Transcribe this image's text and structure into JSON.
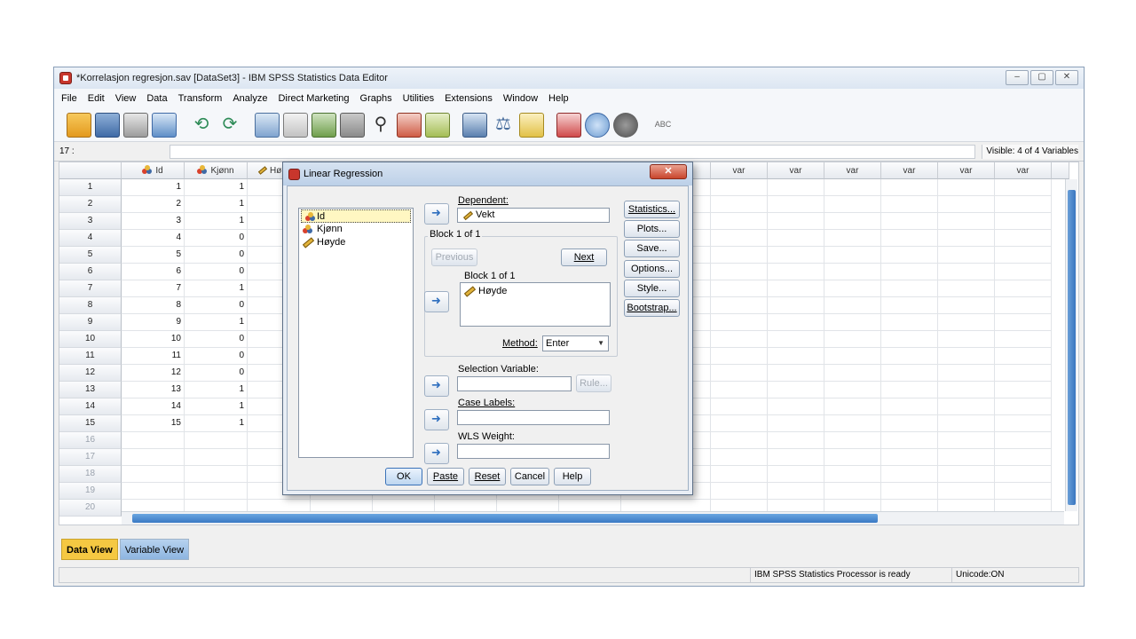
{
  "window": {
    "title": "*Korrelasjon regresjon.sav [DataSet3] - IBM SPSS Statistics Data Editor",
    "controls": [
      "–",
      "▢",
      "✕"
    ]
  },
  "menu": [
    "File",
    "Edit",
    "View",
    "Data",
    "Transform",
    "Analyze",
    "Direct Marketing",
    "Graphs",
    "Utilities",
    "Extensions",
    "Window",
    "Help"
  ],
  "cellbar": {
    "ref": "17 :",
    "visible": "Visible: 4 of 4 Variables"
  },
  "grid": {
    "columns": [
      "Id",
      "Kjønn",
      "Hø",
      "var",
      "var",
      "var",
      "var",
      "var",
      "var"
    ],
    "rows": [
      {
        "n": "1",
        "id": "1",
        "kjonn": "1"
      },
      {
        "n": "2",
        "id": "2",
        "kjonn": "1"
      },
      {
        "n": "3",
        "id": "3",
        "kjonn": "1"
      },
      {
        "n": "4",
        "id": "4",
        "kjonn": "0"
      },
      {
        "n": "5",
        "id": "5",
        "kjonn": "0"
      },
      {
        "n": "6",
        "id": "6",
        "kjonn": "0"
      },
      {
        "n": "7",
        "id": "7",
        "kjonn": "1"
      },
      {
        "n": "8",
        "id": "8",
        "kjonn": "0"
      },
      {
        "n": "9",
        "id": "9",
        "kjonn": "1"
      },
      {
        "n": "10",
        "id": "10",
        "kjonn": "0"
      },
      {
        "n": "11",
        "id": "11",
        "kjonn": "0"
      },
      {
        "n": "12",
        "id": "12",
        "kjonn": "0"
      },
      {
        "n": "13",
        "id": "13",
        "kjonn": "1"
      },
      {
        "n": "14",
        "id": "14",
        "kjonn": "1"
      },
      {
        "n": "15",
        "id": "15",
        "kjonn": "1"
      },
      {
        "n": "16",
        "id": "",
        "kjonn": ""
      },
      {
        "n": "17",
        "id": "",
        "kjonn": ""
      },
      {
        "n": "18",
        "id": "",
        "kjonn": ""
      },
      {
        "n": "19",
        "id": "",
        "kjonn": ""
      },
      {
        "n": "20",
        "id": "",
        "kjonn": ""
      }
    ]
  },
  "tabs": {
    "data_view": "Data View",
    "variable_view": "Variable View"
  },
  "status": {
    "processor": "IBM SPSS Statistics Processor is ready",
    "unicode": "Unicode:ON"
  },
  "dialog": {
    "title": "Linear Regression",
    "close": "✕",
    "variables": [
      "Id",
      "Kjønn",
      "Høyde"
    ],
    "dependent_label": "Dependent:",
    "dependent_value": "Vekt",
    "block_group": "Block 1 of 1",
    "previous": "Previous",
    "next": "Next",
    "block_label": "Block 1 of 1",
    "independent_value": "Høyde",
    "method_label": "Method:",
    "method_value": "Enter",
    "selection_label": "Selection Variable:",
    "rule": "Rule...",
    "case_labels": "Case Labels:",
    "wls_weight": "WLS Weight:",
    "side_buttons": [
      "Statistics...",
      "Plots...",
      "Save...",
      "Options...",
      "Style...",
      "Bootstrap..."
    ],
    "bottom_buttons": [
      "OK",
      "Paste",
      "Reset",
      "Cancel",
      "Help"
    ]
  },
  "colors": {
    "accent": "#3a76c0",
    "active_tab": "#f5c842"
  }
}
